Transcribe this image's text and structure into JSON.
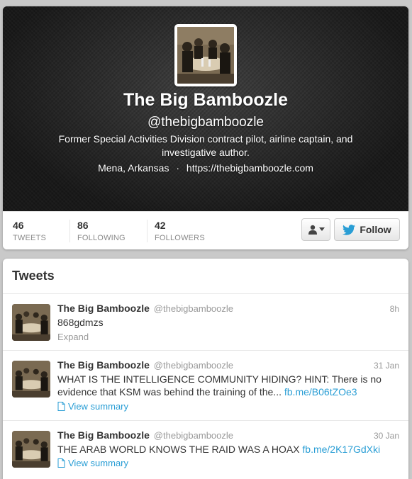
{
  "profile": {
    "name": "The Big Bamboozle",
    "handle": "@thebigbamboozle",
    "bio": "Former Special Activities Division contract pilot, airline captain, and investigative author.",
    "location": "Mena, Arkansas",
    "separator": "·",
    "website": "https://thebigbamboozle.com"
  },
  "stats": [
    {
      "value": "46",
      "label": "TWEETS"
    },
    {
      "value": "86",
      "label": "FOLLOWING"
    },
    {
      "value": "42",
      "label": "FOLLOWERS"
    }
  ],
  "actions": {
    "user_dropdown_icon": "person-icon",
    "follow_label": "Follow"
  },
  "tweets_section": {
    "heading": "Tweets"
  },
  "tweets": [
    {
      "name": "The Big Bamboozle",
      "handle": "@thebigbamboozle",
      "time": "8h",
      "text": "868gdmzs",
      "link": "",
      "action": "Expand"
    },
    {
      "name": "The Big Bamboozle",
      "handle": "@thebigbamboozle",
      "time": "31 Jan",
      "text": "WHAT IS THE INTELLIGENCE COMMUNITY HIDING? HINT: There is no evidence that KSM was behind the training of the...",
      "link": "fb.me/B06tZOe3",
      "action": "View summary"
    },
    {
      "name": "The Big Bamboozle",
      "handle": "@thebigbamboozle",
      "time": "30 Jan",
      "text": "THE ARAB WORLD KNOWS THE RAID WAS A HOAX",
      "link": "fb.me/2K17GdXki",
      "action": "View summary"
    }
  ],
  "colors": {
    "link": "#2a9ed5",
    "twitter_bird": "#2a9ed5",
    "header_bg": "#1c1c1c"
  }
}
